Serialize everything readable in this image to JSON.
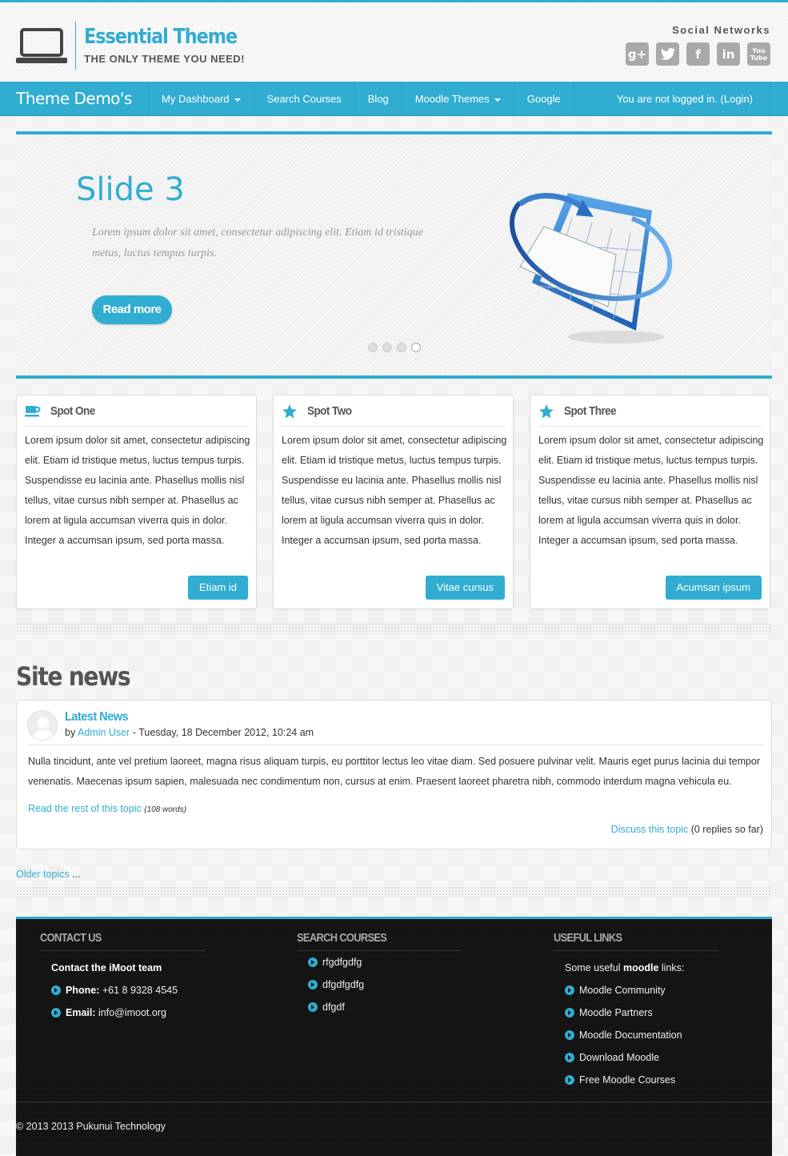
{
  "header": {
    "site_title": "Essential Theme",
    "tagline": "THE ONLY THEME YOU NEED!",
    "social_title": "Social Networks",
    "social_icons": [
      "google-plus-icon",
      "twitter-icon",
      "facebook-icon",
      "linkedin-icon",
      "youtube-icon"
    ],
    "youtube_label": "You Tube"
  },
  "nav": {
    "brand": "Theme Demo's",
    "items": [
      {
        "label": "My Dashboard",
        "dropdown": true
      },
      {
        "label": "Search Courses",
        "dropdown": false
      },
      {
        "label": "Blog",
        "dropdown": false
      },
      {
        "label": "Moodle Themes",
        "dropdown": true
      },
      {
        "label": "Google",
        "dropdown": false
      }
    ],
    "login_text": "You are not logged in. (Login)"
  },
  "slider": {
    "title": "Slide 3",
    "caption": "Lorem ipsum dolor sit amet, consectetur adipiscing elit. Etiam id tristique metus, luctus tempus turpis.",
    "button": "Read more",
    "dots": 4,
    "active_dot": 4
  },
  "spots": [
    {
      "title": "Spot One",
      "icon": "coffee-cup-icon",
      "text": "Lorem ipsum dolor sit amet, consectetur adipiscing elit. Etiam id tristique metus, luctus tempus turpis. Suspendisse eu lacinia ante. Phasellus mollis nisl tellus, vitae cursus nibh semper at. Phasellus ac lorem at ligula accumsan viverra quis in dolor. Integer a accumsan ipsum, sed porta massa.",
      "button": "Etiam id"
    },
    {
      "title": "Spot Two",
      "icon": "star-icon",
      "text": "Lorem ipsum dolor sit amet, consectetur adipiscing elit. Etiam id tristique metus, luctus tempus turpis. Suspendisse eu lacinia ante. Phasellus mollis nisl tellus, vitae cursus nibh semper at. Phasellus ac lorem at ligula accumsan viverra quis in dolor. Integer a accumsan ipsum, sed porta massa.",
      "button": "Vitae cursus"
    },
    {
      "title": "Spot Three",
      "icon": "star-icon",
      "text": "Lorem ipsum dolor sit amet, consectetur adipiscing elit. Etiam id tristique metus, luctus tempus turpis. Suspendisse eu lacinia ante. Phasellus mollis nisl tellus, vitae cursus nibh semper at. Phasellus ac lorem at ligula accumsan viverra quis in dolor. Integer a accumsan ipsum, sed porta massa.",
      "button": "Acumsan ipsum"
    }
  ],
  "news": {
    "heading": "Site news",
    "post_title": "Latest News",
    "by": "by",
    "author": "Admin User",
    "date": "- Tuesday, 18 December 2012, 10:24 am",
    "body": "Nulla tincidunt, ante vel pretium laoreet, magna risus aliquam turpis, eu porttitor lectus leo vitae diam. Sed posuere pulvinar velit. Mauris eget purus lacinia dui tempor venenatis. Maecenas ipsum sapien, malesuada nec condimentum non, cursus at enim. Praesent laoreet pharetra nibh, commodo interdum magna vehicula eu.",
    "read_rest": "Read the rest of this topic",
    "word_count": "(108 words)",
    "discuss": "Discuss this topic",
    "replies": "(0 replies so far)",
    "older": "Older topics",
    "older_suffix": " ..."
  },
  "footer": {
    "contact": {
      "heading": "CONTACT US",
      "team": "Contact the iMoot team",
      "phone_label": "Phone:",
      "phone": "+61 8 9328 4545",
      "email_label": "Email:",
      "email": "info@imoot.org"
    },
    "search": {
      "heading": "SEARCH COURSES",
      "items": [
        "rfgdfgdfg",
        "dfgdfgdfg",
        "dfgdf"
      ]
    },
    "links": {
      "heading": "USEFUL LINKS",
      "intro_pre": "Some useful ",
      "intro_bold": "moodle",
      "intro_post": " links:",
      "items": [
        "Moodle Community",
        "Moodle Partners",
        "Moodle Documentation",
        "Download Moodle",
        "Free Moodle Courses"
      ]
    },
    "copyright": "© 2013 2013 Pukunui Technology"
  },
  "colors": {
    "accent": "#30add1",
    "footer_bg": "#111111",
    "social_grey": "#a9a9a9"
  }
}
